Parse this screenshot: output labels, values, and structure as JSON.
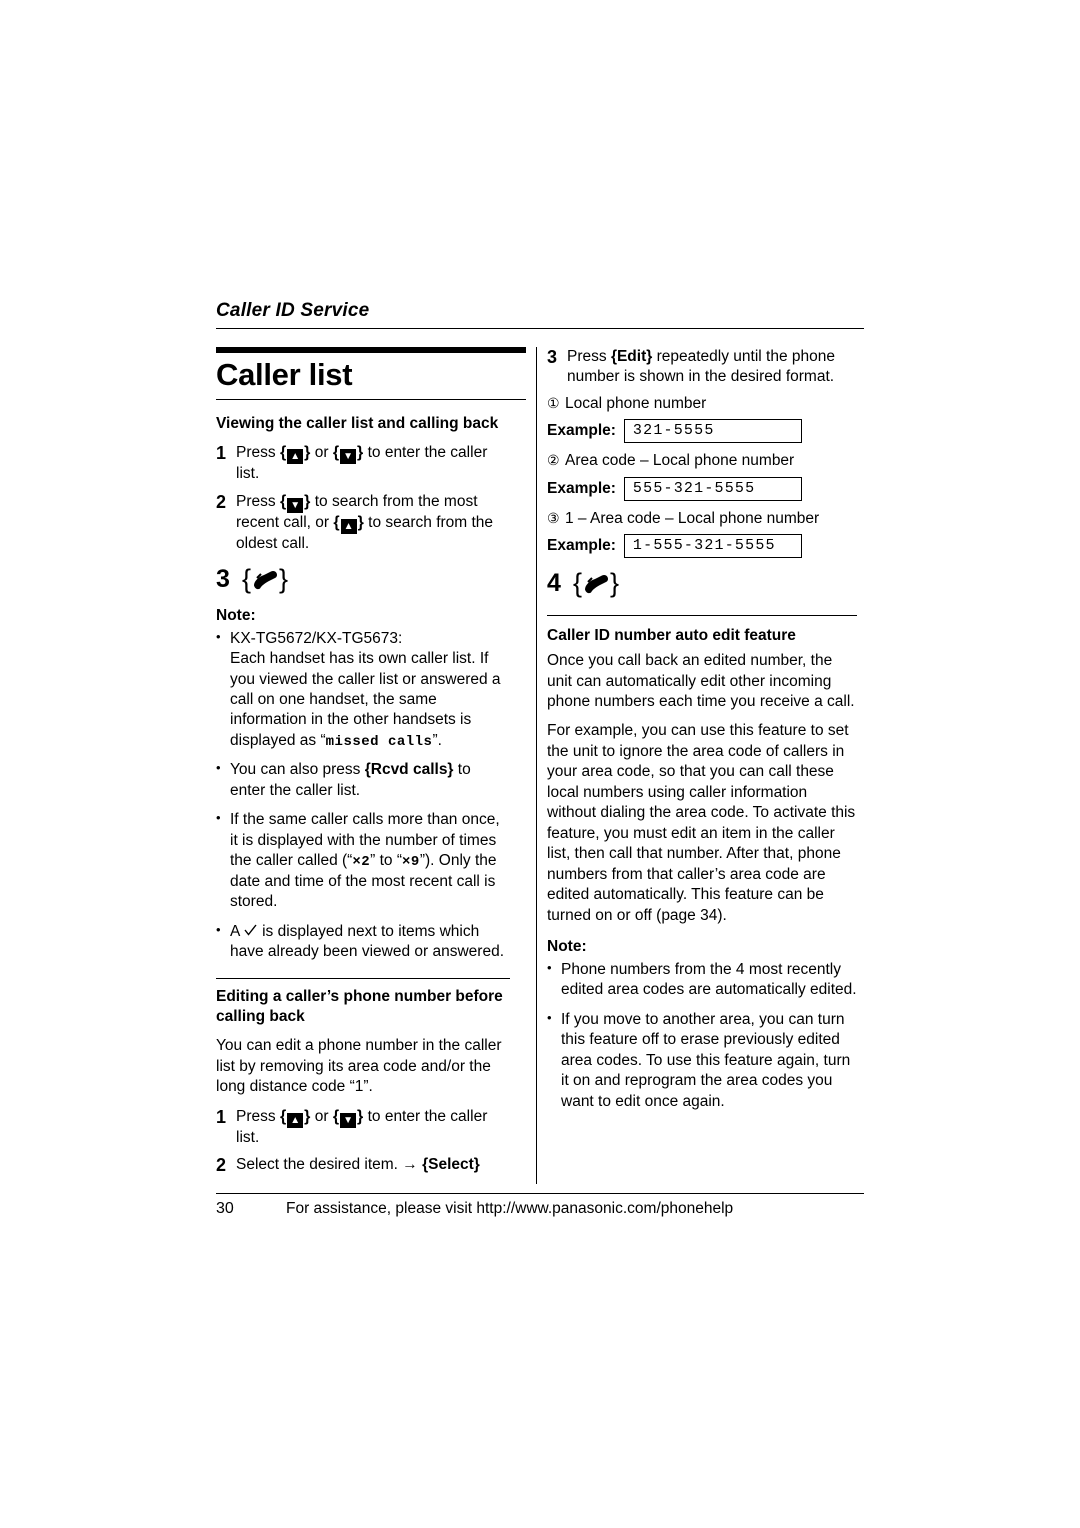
{
  "header": {
    "title": "Caller ID Service"
  },
  "left": {
    "title": "Caller list",
    "section1_heading": "Viewing the caller list and calling back",
    "steps": [
      {
        "num": "1",
        "text_before": "Press ",
        "key1": "▲",
        "mid": " or ",
        "key2": "▼",
        "text_after": " to enter the caller list."
      },
      {
        "num": "2",
        "text_before": "Press ",
        "key1": "▼",
        "mid": " to search from the most recent call, or ",
        "key2": "▲",
        "text_after": " to search from the oldest call."
      }
    ],
    "step3_num": "3",
    "note_heading": "Note:",
    "notes": [
      {
        "lead": "KX-TG5672/KX-TG5673:",
        "body": "Each handset has its own caller list. If you viewed the caller list or answered a call on one handset, the same information in the other handsets is displayed as “",
        "mono": "missed calls",
        "tail": "”."
      },
      {
        "body_pre": "You can also press ",
        "key": "{Rcvd calls}",
        "body_post": " to enter the caller list."
      },
      {
        "body": "If the same caller calls more than once, it is displayed with the number of times the caller called (“",
        "mono1": "×2",
        "mid": "” to “",
        "mono2": "×9",
        "tail": "”). Only the date and time of the most recent call is stored."
      },
      {
        "pre": "A ",
        "post": " is displayed next to items which have already been viewed or answered."
      }
    ],
    "section2_heading": "Editing a caller’s phone number before calling back",
    "section2_para": "You can edit a phone number in the caller list by removing its area code and/or the long distance code “1”.",
    "section2_steps": [
      {
        "num": "1",
        "text_before": "Press ",
        "key1": "▲",
        "mid": " or ",
        "key2": "▼",
        "text_after": " to enter the caller list."
      },
      {
        "num": "2",
        "text": "Select the desired item. ",
        "arrow": "→",
        "key": "{Select}"
      }
    ]
  },
  "right": {
    "step3": {
      "num": "3",
      "text_pre": "Press ",
      "key": "{Edit}",
      "text_post": " repeatedly until the phone number is shown in the desired format."
    },
    "formats": [
      {
        "mark": "①",
        "label": "Local phone number",
        "example_label": "Example:",
        "example_value": "321-5555"
      },
      {
        "mark": "②",
        "label": "Area code – Local phone number",
        "example_label": "Example:",
        "example_value": "555-321-5555"
      },
      {
        "mark": "③",
        "label": "1 – Area code – Local phone number",
        "example_label": "Example:",
        "example_value": "1-555-321-5555"
      }
    ],
    "step4_num": "4",
    "auto_edit_heading": "Caller ID number auto edit feature",
    "auto_edit_paras": [
      "Once you call back an edited number, the unit can automatically edit other incoming phone numbers each time you receive a call.",
      "For example, you can use this feature to set the unit to ignore the area code of callers in your area code, so that you can call these local numbers using caller information without dialing the area code. To activate this feature, you must edit an item in the caller list, then call that number. After that, phone numbers from that caller’s area code are edited automatically. This feature can be turned on or off (page 34)."
    ],
    "note_heading": "Note:",
    "notes": [
      "Phone numbers from the 4 most recently edited area codes are automatically edited.",
      "If you move to another area, you can turn this feature off to erase previously edited area codes. To use this feature again, turn it on and reprogram the area codes you want to edit once again."
    ]
  },
  "footer": {
    "page_number": "30",
    "text": "For assistance, please visit http://www.panasonic.com/phonehelp"
  }
}
